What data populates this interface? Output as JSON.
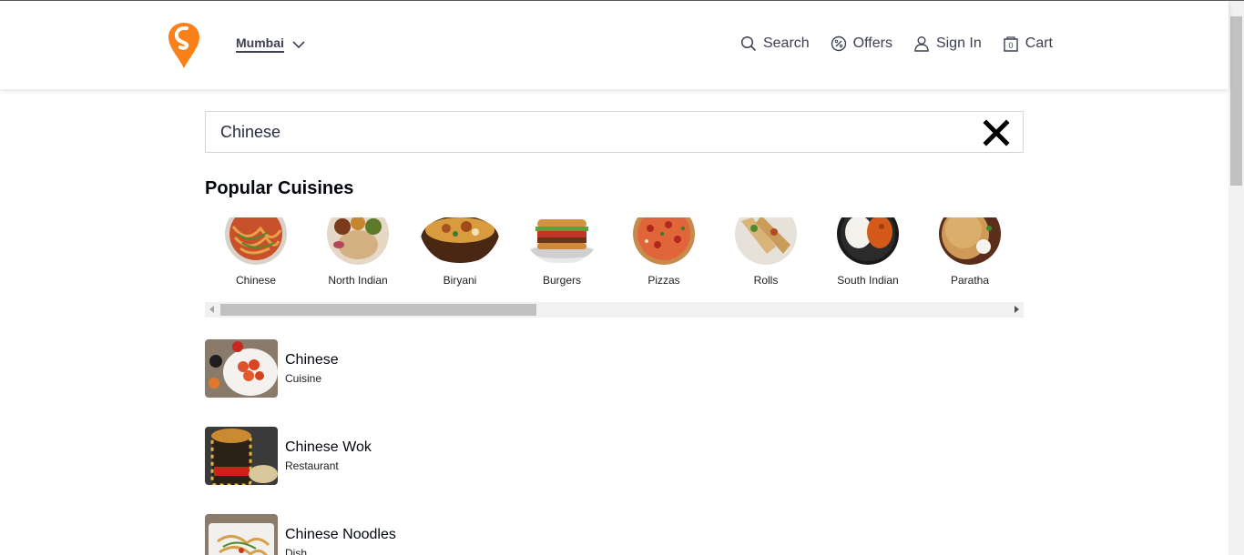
{
  "header": {
    "location": "Mumbai",
    "nav": [
      {
        "label": "Search",
        "icon": "search-icon"
      },
      {
        "label": "Offers",
        "icon": "offers-icon"
      },
      {
        "label": "Sign In",
        "icon": "user-icon"
      },
      {
        "label": "Cart",
        "icon": "cart-icon",
        "count": "0"
      }
    ],
    "brand_color": "#fc8019"
  },
  "search": {
    "value": "Chinese"
  },
  "popular": {
    "title": "Popular Cuisines",
    "items": [
      {
        "label": "Chinese",
        "icon": "chinese-food-image"
      },
      {
        "label": "North Indian",
        "icon": "north-indian-food-image"
      },
      {
        "label": "Biryani",
        "icon": "biryani-image"
      },
      {
        "label": "Burgers",
        "icon": "burger-image"
      },
      {
        "label": "Pizzas",
        "icon": "pizza-image"
      },
      {
        "label": "Rolls",
        "icon": "rolls-image"
      },
      {
        "label": "South Indian",
        "icon": "south-indian-food-image"
      },
      {
        "label": "Paratha",
        "icon": "paratha-image"
      }
    ]
  },
  "results": [
    {
      "name": "Chinese",
      "type": "Cuisine"
    },
    {
      "name": "Chinese Wok",
      "type": "Restaurant"
    },
    {
      "name": "Chinese Noodles",
      "type": "Dish"
    }
  ]
}
